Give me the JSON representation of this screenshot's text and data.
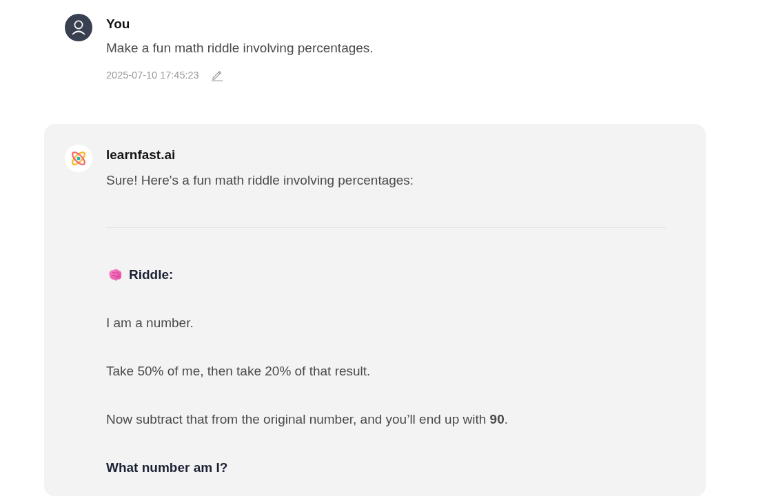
{
  "messages": [
    {
      "kind": "user",
      "author": "You",
      "text": "Make a fun math riddle involving percentages.",
      "timestamp": "2025-07-10 17:45:23"
    },
    {
      "kind": "assistant",
      "author": "learnfast.ai",
      "blocks": [
        {
          "kind": "paragraph",
          "text": "Sure! Here's a fun math riddle involving percentages:"
        },
        {
          "kind": "rule"
        },
        {
          "kind": "heading",
          "text": "Riddle:"
        },
        {
          "kind": "paragraph",
          "text": "I am a number."
        },
        {
          "kind": "paragraph",
          "text": "Take 50% of me, then take 20% of that result."
        },
        {
          "kind": "paragraph",
          "text": "Now subtract that from the original number, and you’ll end up with **90**."
        },
        {
          "kind": "strong",
          "text": "What number am I?"
        }
      ]
    }
  ]
}
